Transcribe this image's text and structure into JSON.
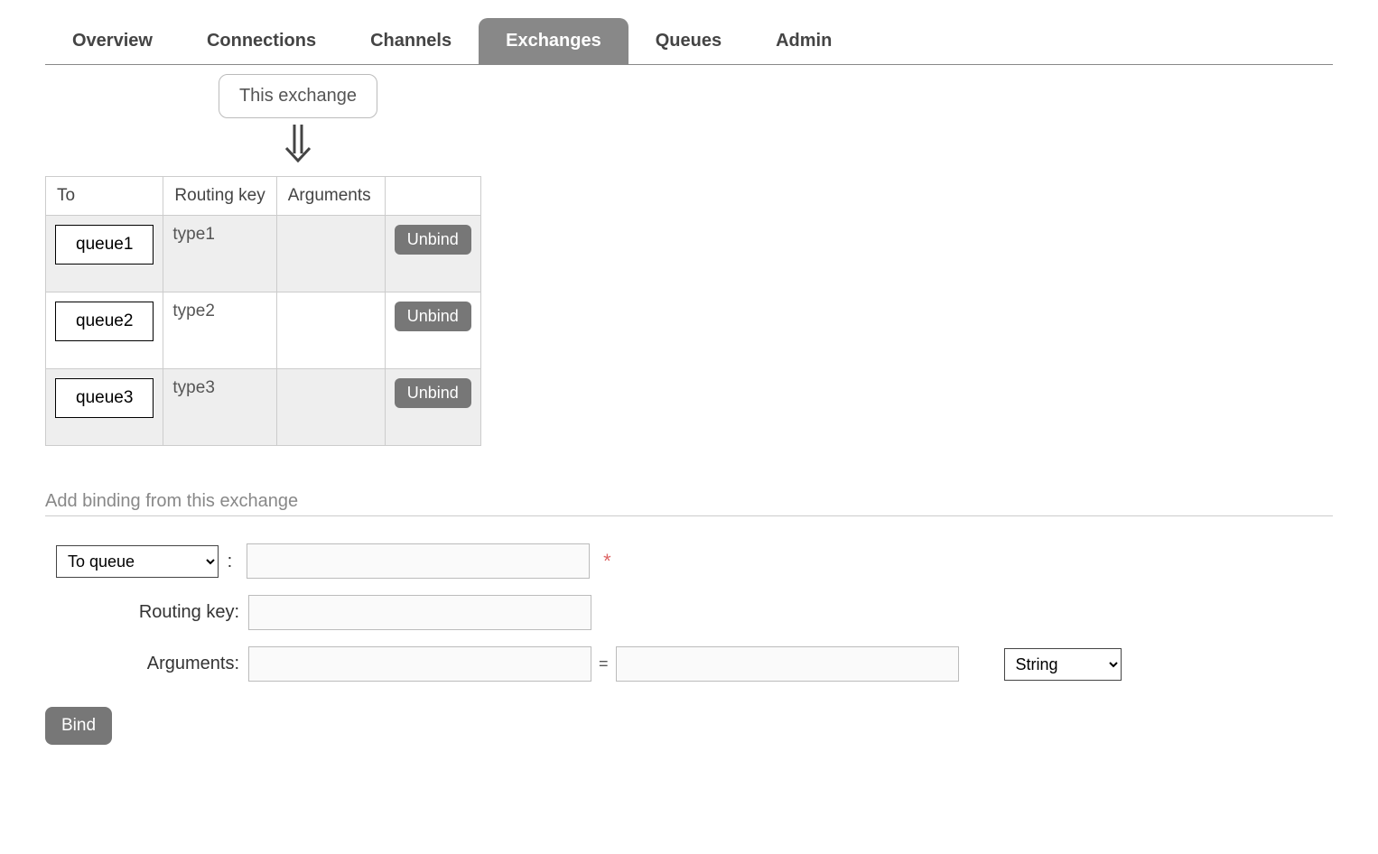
{
  "tabs": [
    {
      "label": "Overview",
      "active": false
    },
    {
      "label": "Connections",
      "active": false
    },
    {
      "label": "Channels",
      "active": false
    },
    {
      "label": "Exchanges",
      "active": true
    },
    {
      "label": "Queues",
      "active": false
    },
    {
      "label": "Admin",
      "active": false
    }
  ],
  "diagram": {
    "source_label": "This exchange"
  },
  "bindings_table": {
    "headers": {
      "to": "To",
      "routing_key": "Routing key",
      "arguments": "Arguments"
    },
    "rows": [
      {
        "to": "queue1",
        "routing_key": "type1",
        "arguments": "",
        "action": "Unbind"
      },
      {
        "to": "queue2",
        "routing_key": "type2",
        "arguments": "",
        "action": "Unbind"
      },
      {
        "to": "queue3",
        "routing_key": "type3",
        "arguments": "",
        "action": "Unbind"
      }
    ]
  },
  "add_binding": {
    "title": "Add binding from this exchange",
    "destination_select": "To queue",
    "destination_value": "",
    "routing_key_label": "Routing key:",
    "routing_key_value": "",
    "arguments_label": "Arguments:",
    "arg_key": "",
    "arg_value": "",
    "arg_type": "String",
    "required_marker": "*",
    "bind_button": "Bind"
  }
}
